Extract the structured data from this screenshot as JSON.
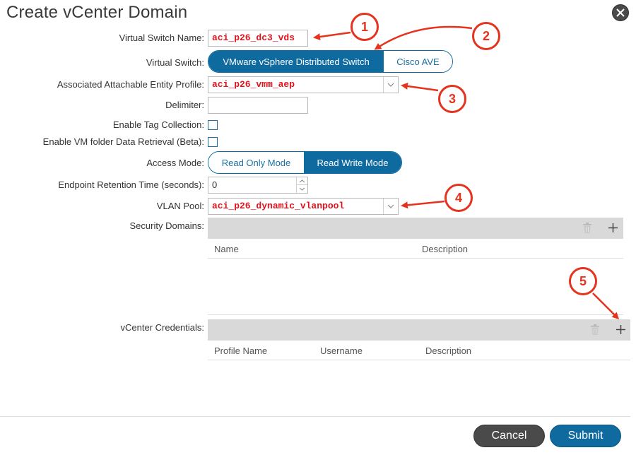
{
  "dialog": {
    "title": "Create vCenter Domain"
  },
  "form": {
    "virtual_switch_name_label": "Virtual Switch Name:",
    "virtual_switch_name_value": "aci_p26_dc3_vds",
    "virtual_switch_label": "Virtual Switch:",
    "virtual_switch_options": [
      "VMware vSphere Distributed Switch",
      "Cisco AVE"
    ],
    "virtual_switch_selected": "VMware vSphere Distributed Switch",
    "aep_label": "Associated Attachable Entity Profile:",
    "aep_value": "aci_p26_vmm_aep",
    "delimiter_label": "Delimiter:",
    "delimiter_value": "",
    "tag_collection_label": "Enable Tag Collection:",
    "tag_collection_checked": false,
    "vm_folder_label": "Enable VM folder Data Retrieval (Beta):",
    "vm_folder_checked": false,
    "access_mode_label": "Access Mode:",
    "access_mode_options": [
      "Read Only Mode",
      "Read Write Mode"
    ],
    "access_mode_selected": "Read Write Mode",
    "endpoint_retention_label": "Endpoint Retention Time (seconds):",
    "endpoint_retention_value": "0",
    "vlan_pool_label": "VLAN Pool:",
    "vlan_pool_value": "aci_p26_dynamic_vlanpool",
    "security_domains_label": "Security Domains:",
    "security_domains_columns": [
      "Name",
      "Description"
    ],
    "vcenter_credentials_label": "vCenter Credentials:",
    "vcenter_credentials_columns": [
      "Profile Name",
      "Username",
      "Description"
    ]
  },
  "footer": {
    "cancel_label": "Cancel",
    "submit_label": "Submit"
  },
  "callouts": [
    "1",
    "2",
    "3",
    "4",
    "5"
  ],
  "colors": {
    "accent": "#0f6aa0",
    "callout": "#e5331e",
    "value_red": "#e3121b"
  },
  "icons": {
    "close": "close-icon",
    "trash": "trash-icon",
    "add": "plus-icon",
    "dropdown": "chevron-down-icon"
  }
}
